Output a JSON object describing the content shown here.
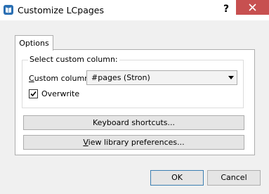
{
  "window": {
    "title": "Customize LCpages",
    "help_label": "?"
  },
  "tabs": [
    {
      "label": "Options"
    }
  ],
  "group": {
    "title": "Select custom column:",
    "field_label_first": "C",
    "field_label_rest": "ustom column:",
    "select_value": "#pages (Stron)",
    "checkbox_label": "Overwrite",
    "checkbox_checked": true
  },
  "buttons": {
    "keyboard_shortcuts": "Keyboard shortcuts...",
    "view_prefs_first": "V",
    "view_prefs_rest": "iew library preferences...",
    "ok": "OK",
    "cancel": "Cancel"
  },
  "colors": {
    "close_button": "#c75050",
    "app_icon": "#2a6fb3"
  },
  "icons": {
    "app": "book-icon",
    "close": "close-icon",
    "dropdown": "chevron-down-icon",
    "check": "checkmark-icon"
  }
}
